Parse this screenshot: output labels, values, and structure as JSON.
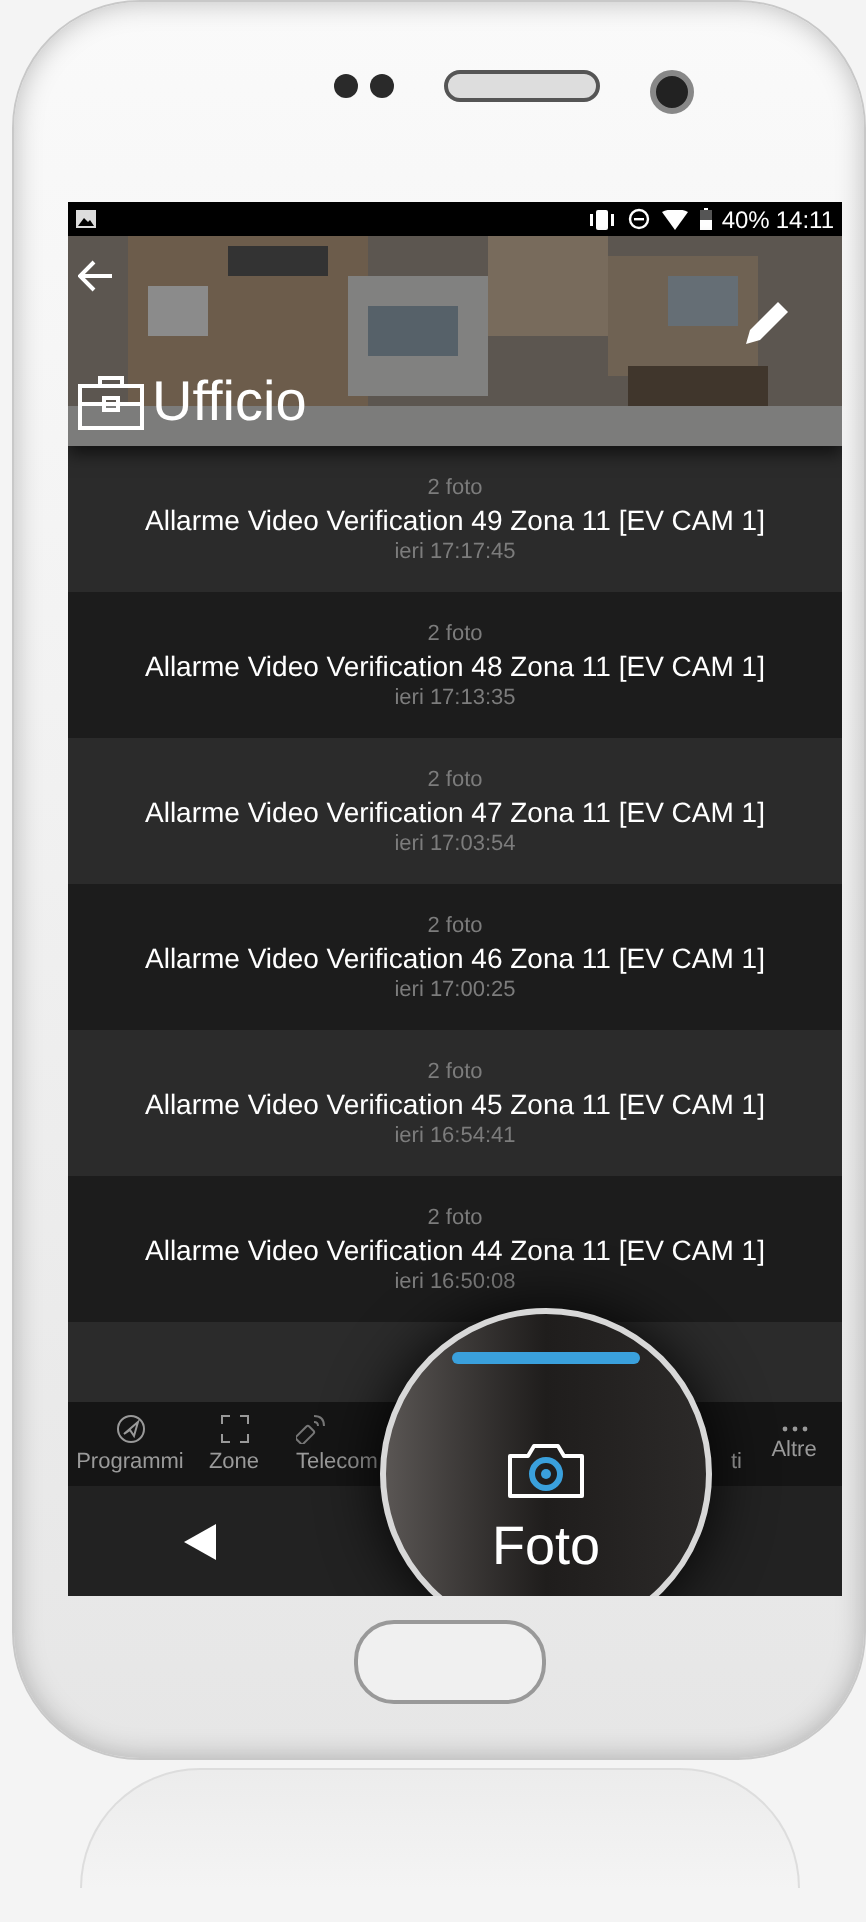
{
  "status_bar": {
    "battery": "40%",
    "time": "14:11"
  },
  "header": {
    "title": "Ufficio"
  },
  "events": [
    {
      "count": "2 foto",
      "title": "Allarme Video Verification 49 Zona 11 [EV CAM 1]",
      "time": "ieri 17:17:45"
    },
    {
      "count": "2 foto",
      "title": "Allarme Video Verification 48 Zona 11 [EV CAM 1]",
      "time": "ieri 17:13:35"
    },
    {
      "count": "2 foto",
      "title": "Allarme Video Verification 47 Zona 11 [EV CAM 1]",
      "time": "ieri 17:03:54"
    },
    {
      "count": "2 foto",
      "title": "Allarme Video Verification 46 Zona 11 [EV CAM 1]",
      "time": "ieri 17:00:25"
    },
    {
      "count": "2 foto",
      "title": "Allarme Video Verification 45 Zona 11 [EV CAM 1]",
      "time": "ieri 16:54:41"
    },
    {
      "count": "2 foto",
      "title": "Allarme Video Verification 44 Zona 11 [EV CAM 1]",
      "time": "ieri 16:50:08"
    }
  ],
  "tab_bar": {
    "items": [
      {
        "kind": "plane",
        "label": "Programmi"
      },
      {
        "kind": "frame",
        "label": "Zone"
      },
      {
        "kind": "remote",
        "label": "Telecom"
      },
      {
        "kind": "covered",
        "label": "ti"
      },
      {
        "kind": "more",
        "label": "Altre"
      }
    ]
  },
  "magnifier": {
    "label": "Foto",
    "selected": true
  }
}
